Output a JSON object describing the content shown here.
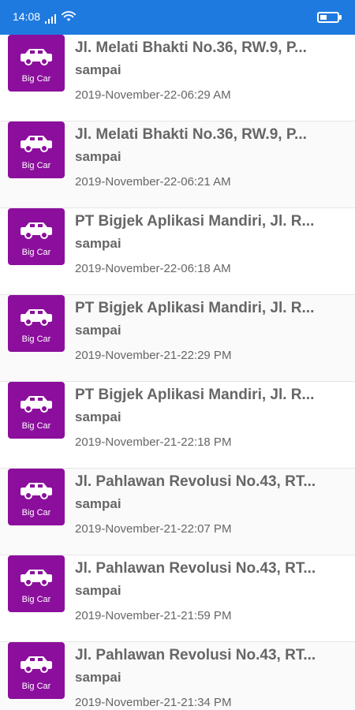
{
  "status_bar": {
    "time": "14:08",
    "signal_icon": "signal-icon",
    "wifi_icon": "wifi-icon",
    "battery_icon": "battery-icon",
    "bg_color": "#1f7ae0"
  },
  "rides": [
    {
      "badge_label": "Big Car",
      "title": "Jl. Melati Bhakti No.36, RW.9, P...",
      "subtitle": "sampai",
      "timestamp": "2019-November-22-06:29 AM"
    },
    {
      "badge_label": "Big Car",
      "title": "Jl. Melati Bhakti No.36, RW.9, P...",
      "subtitle": "sampai",
      "timestamp": "2019-November-22-06:21 AM"
    },
    {
      "badge_label": "Big Car",
      "title": "PT Bigjek Aplikasi Mandiri, Jl. R...",
      "subtitle": "sampai",
      "timestamp": "2019-November-22-06:18 AM"
    },
    {
      "badge_label": "Big Car",
      "title": "PT Bigjek Aplikasi Mandiri, Jl. R...",
      "subtitle": "sampai",
      "timestamp": "2019-November-21-22:29 PM"
    },
    {
      "badge_label": "Big Car",
      "title": "PT Bigjek Aplikasi Mandiri, Jl. R...",
      "subtitle": "sampai",
      "timestamp": "2019-November-21-22:18 PM"
    },
    {
      "badge_label": "Big Car",
      "title": "Jl. Pahlawan Revolusi No.43, RT...",
      "subtitle": "sampai",
      "timestamp": "2019-November-21-22:07 PM"
    },
    {
      "badge_label": "Big Car",
      "title": "Jl. Pahlawan Revolusi No.43, RT...",
      "subtitle": "sampai",
      "timestamp": "2019-November-21-21:59 PM"
    },
    {
      "badge_label": "Big Car",
      "title": "Jl. Pahlawan Revolusi No.43, RT...",
      "subtitle": "sampai",
      "timestamp": "2019-November-21-21:34 PM"
    }
  ],
  "colors": {
    "badge": "#8b0f9c",
    "text": "#666666",
    "status_bar": "#1f7ae0"
  },
  "icons": {
    "badge_icon": "car-icon"
  }
}
